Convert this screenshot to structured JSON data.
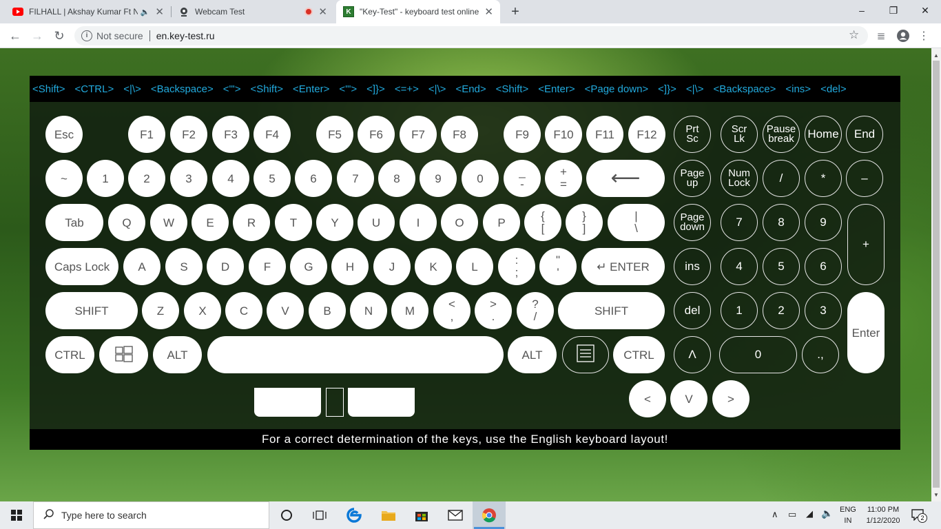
{
  "tabs": [
    {
      "title": "FILHALL | Akshay Kumar Ft N",
      "icon": "youtube-icon"
    },
    {
      "title": "Webcam Test",
      "icon": "webcam-icon"
    },
    {
      "title": "\"Key-Test\" - keyboard test online",
      "icon": "key-test-icon",
      "favicon_letter": "K"
    }
  ],
  "window_buttons": {
    "minimize": "–",
    "maximize": "❐",
    "close": "✕"
  },
  "address": {
    "security": "Not secure",
    "url": "en.key-test.ru"
  },
  "history": [
    "<Shift>",
    "<CTRL>",
    "<|\\>",
    "<Backspace>",
    "<'\">",
    "<Shift>",
    "<Enter>",
    "<'\">",
    "<]}>",
    "<=+>",
    "<|\\>",
    "<End>",
    "<Shift>",
    "<Enter>",
    "<Page down>",
    "<]}>",
    "<|\\>",
    "<Backspace>",
    "<ins>",
    "<del>"
  ],
  "hint": "For a correct determination of the keys, use the English keyboard layout!",
  "keys": {
    "esc": "Esc",
    "f1": "F1",
    "f2": "F2",
    "f3": "F3",
    "f4": "F4",
    "f5": "F5",
    "f6": "F6",
    "f7": "F7",
    "f8": "F8",
    "f9": "F9",
    "f10": "F10",
    "f11": "F11",
    "f12": "F12",
    "tilde": "~",
    "n1": "1",
    "n2": "2",
    "n3": "3",
    "n4": "4",
    "n5": "5",
    "n6": "6",
    "n7": "7",
    "n8": "8",
    "n9": "9",
    "n0": "0",
    "minus_top": "_",
    "minus_bot": "-",
    "plus_top": "+",
    "plus_bot": "=",
    "backspace": "⟵",
    "tab": "Tab",
    "q": "Q",
    "w": "W",
    "e": "E",
    "r": "R",
    "t": "T",
    "y": "Y",
    "u": "U",
    "i": "I",
    "o": "O",
    "p": "P",
    "lbr_top": "{",
    "lbr_bot": "[",
    "rbr_top": "}",
    "rbr_bot": "]",
    "pipe_top": "|",
    "pipe_bot": "\\",
    "caps": "Caps Lock",
    "a": "A",
    "s": "S",
    "d": "D",
    "f": "F",
    "g": "G",
    "h": "H",
    "j": "J",
    "k": "K",
    "l": "L",
    "semi_top": ":",
    "semi_bot": ";",
    "quote_top": "\"",
    "quote_bot": "'",
    "enter": "↵ ENTER",
    "shift_l": "SHIFT",
    "z": "Z",
    "x": "X",
    "c": "C",
    "v": "V",
    "b": "B",
    "n": "N",
    "m": "M",
    "comma_top": "<",
    "comma_bot": ",",
    "dot_top": ">",
    "dot_bot": ".",
    "slash_top": "?",
    "slash_bot": "/",
    "shift_r": "SHIFT",
    "ctrl_l": "CTRL",
    "alt_l": "ALT",
    "alt_r": "ALT",
    "ctrl_r": "CTRL",
    "prtsc_1": "Prt",
    "prtsc_2": "Sc",
    "scrlk_1": "Scr",
    "scrlk_2": "Lk",
    "pause_1": "Pause",
    "pause_2": "break",
    "home": "Home",
    "end": "End",
    "pgup_1": "Page",
    "pgup_2": "up",
    "numlock_1": "Num",
    "numlock_2": "Lock",
    "nslash": "/",
    "nstar": "*",
    "nminus": "–",
    "pgdn_1": "Page",
    "pgdn_2": "down",
    "np7": "7",
    "np8": "8",
    "np9": "9",
    "nplus": "+",
    "ins": "ins",
    "np4": "4",
    "np5": "5",
    "np6": "6",
    "del": "del",
    "np1": "1",
    "np2": "2",
    "np3": "3",
    "nenter": "Enter",
    "up": "Λ",
    "np0": "0",
    "npdot": ".,",
    "left": "<",
    "down": "V",
    "right": ">"
  },
  "taskbar": {
    "search_placeholder": "Type here to search",
    "lang1": "ENG",
    "lang2": "IN",
    "time": "11:00 PM",
    "date": "1/12/2020",
    "notif_count": "2"
  }
}
